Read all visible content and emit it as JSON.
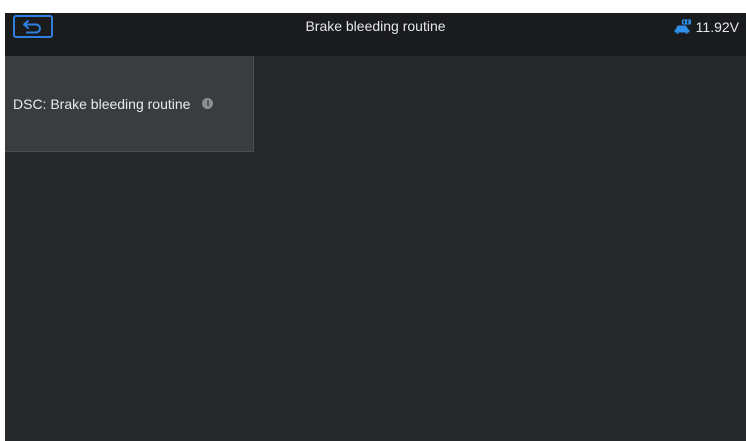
{
  "header": {
    "title": "Brake bleeding routine",
    "back_icon": "back-arrow-icon",
    "battery_icon": "vehicle-battery-icon",
    "voltage": "11.92V"
  },
  "menu": {
    "items": [
      {
        "label": "DSC: Brake bleeding routine",
        "icon": "info-icon",
        "icon_glyph": "i"
      }
    ]
  },
  "colors": {
    "titlebar_bg": "#1a1b1d",
    "content_bg": "#26282b",
    "item_bg": "#3a3c40",
    "accent": "#2f7fe0",
    "text": "#e4e6ea"
  }
}
